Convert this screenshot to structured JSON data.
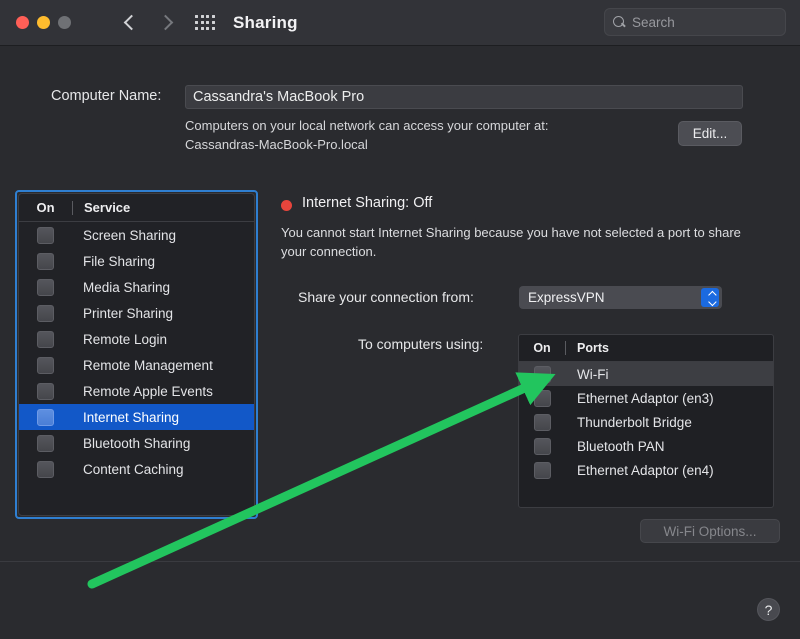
{
  "window": {
    "title": "Sharing",
    "traffic_lights": [
      "close",
      "minimize",
      "zoom"
    ],
    "back_icon": "chevron-left-icon",
    "forward_icon": "chevron-right-icon",
    "show_all_icon": "grid-icon"
  },
  "search": {
    "placeholder": "Search",
    "value": "",
    "icon": "search-icon"
  },
  "computer_name": {
    "label": "Computer Name:",
    "value": "Cassandra's MacBook Pro",
    "help_line1": "Computers on your local network can access your computer at:",
    "help_line2": "Cassandras-MacBook-Pro.local",
    "edit_label": "Edit..."
  },
  "services": {
    "columns": {
      "on": "On",
      "name": "Service"
    },
    "items": [
      {
        "label": "Screen Sharing",
        "on": false,
        "selected": false
      },
      {
        "label": "File Sharing",
        "on": false,
        "selected": false
      },
      {
        "label": "Media Sharing",
        "on": false,
        "selected": false
      },
      {
        "label": "Printer Sharing",
        "on": false,
        "selected": false
      },
      {
        "label": "Remote Login",
        "on": false,
        "selected": false
      },
      {
        "label": "Remote Management",
        "on": false,
        "selected": false
      },
      {
        "label": "Remote Apple Events",
        "on": false,
        "selected": false
      },
      {
        "label": "Internet Sharing",
        "on": false,
        "selected": true
      },
      {
        "label": "Bluetooth Sharing",
        "on": false,
        "selected": false
      },
      {
        "label": "Content Caching",
        "on": false,
        "selected": false
      }
    ]
  },
  "detail": {
    "status_label": "Internet Sharing: Off",
    "status_color": "#e8453c",
    "warning": "You cannot start Internet Sharing because you have not selected a port to share your connection.",
    "share_from_label": "Share your connection from:",
    "share_from_value": "ExpressVPN",
    "ports_label": "To computers using:",
    "ports_columns": {
      "on": "On",
      "name": "Ports"
    },
    "ports": [
      {
        "label": "Wi-Fi",
        "on": false,
        "selected": true
      },
      {
        "label": "Ethernet Adaptor (en3)",
        "on": false,
        "selected": false
      },
      {
        "label": "Thunderbolt Bridge",
        "on": false,
        "selected": false
      },
      {
        "label": "Bluetooth PAN",
        "on": false,
        "selected": false
      },
      {
        "label": "Ethernet Adaptor (en4)",
        "on": false,
        "selected": false
      }
    ],
    "wifi_options_label": "Wi-Fi Options...",
    "wifi_options_enabled": false
  },
  "footer": {
    "help_label": "?"
  },
  "annotations": {
    "arrow_color": "#22c55e",
    "outline_color": "#2f7fd1"
  }
}
